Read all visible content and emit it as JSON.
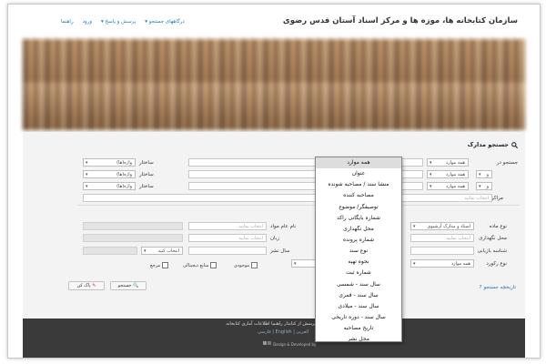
{
  "header": {
    "title": "سازمان کتابخانه ها، موزه ها و مرکز اسناد آستان قدس رضوی",
    "nav": [
      "درگاههای جستجو ▾",
      "پرسش و پاسخ ▾",
      "ورود",
      "راهنما"
    ]
  },
  "search": {
    "title": "جستجو مدارک",
    "search_in_label": "جستجو در",
    "field_value": "همه موارد",
    "rows_logic": [
      "و",
      "و"
    ],
    "criteria": [
      {
        "mode": "ساختار",
        "words": "واژه(ها)"
      },
      {
        "mode": "ساختار",
        "words": "واژه(ها)"
      },
      {
        "mode": "ساختار",
        "words": "واژه(ها)"
      }
    ],
    "centers_label": "مراکز",
    "centers_placeholder": "انتخاب نمایید"
  },
  "filters": {
    "doc_type_label": "نوع ماده",
    "doc_type_value": "اسناد و مدارک آرشیوی",
    "location_label": "محل نگهداری",
    "location_value": "انتخاب نمایید",
    "id_label": "شناسه بازیابی",
    "record_type_label": "نوع رکورد",
    "record_type_value": "همه موارد",
    "publisher_label": "نام عام مواد",
    "publisher_placeholder": "انتخاب نمایید",
    "language_label": "زبان",
    "language_placeholder": "انتخاب نمایید",
    "year_label": "سال نشر",
    "choose_label": "انتخاب کنید",
    "checkbox_available": "موجودی",
    "checkbox_digital": "منابع دیجیتالی",
    "checkbox_ref": "مرجع"
  },
  "buttons": {
    "search": "جستجو",
    "clear": "پاک کن"
  },
  "help_link": "تاریخچه جستجو",
  "footer": {
    "links": "درباره ما   پرسش از کتابدار   راهنما   اطلاعات آماری کتابخانه",
    "lang": "فارسی | English | العربی",
    "credit": "Design & Developed by"
  },
  "dropdown": {
    "items": [
      "همه موارد",
      "عنوان",
      "منشا سند / مصاحبه شونده",
      "مصاحبه کننده",
      "توصیفگر/ موضوع",
      "شماره بایگانی راکد",
      "محل نگهداری",
      "شماره پرونده",
      "نوع سند",
      "نحوه تهیه",
      "شماره ثبت",
      "سال سند - شمسی",
      "سال سند - قمری",
      "سال سند - میلادی",
      "سال سند - دوره تاریخی",
      "تاریخ مصاحبه",
      "محل نشر"
    ]
  }
}
